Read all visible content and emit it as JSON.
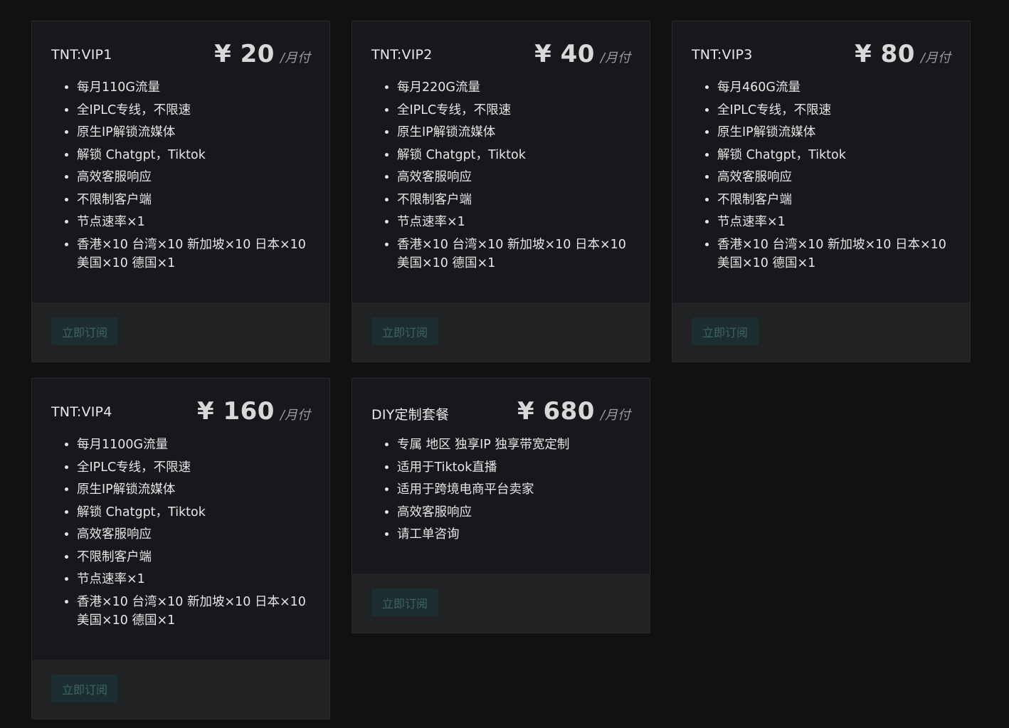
{
  "plans": [
    {
      "name": "TNT:VIP1",
      "price": "¥ 20",
      "unit": "/月付",
      "features": [
        "每月110G流量",
        "全IPLC专线，不限速",
        "原生IP解锁流媒体",
        "解锁 Chatgpt，Tiktok",
        "高效客服响应",
        "不限制客户端",
        "节点速率×1",
        "香港×10 台湾×10 新加坡×10 日本×10 美国×10 德国×1"
      ],
      "button": "立即订阅"
    },
    {
      "name": "TNT:VIP2",
      "price": "¥ 40",
      "unit": "/月付",
      "features": [
        "每月220G流量",
        "全IPLC专线，不限速",
        "原生IP解锁流媒体",
        "解锁 Chatgpt，Tiktok",
        "高效客服响应",
        "不限制客户端",
        "节点速率×1",
        "香港×10 台湾×10 新加坡×10 日本×10 美国×10 德国×1"
      ],
      "button": "立即订阅"
    },
    {
      "name": "TNT:VIP3",
      "price": "¥ 80",
      "unit": "/月付",
      "features": [
        "每月460G流量",
        "全IPLC专线，不限速",
        "原生IP解锁流媒体",
        "解锁 Chatgpt，Tiktok",
        "高效客服响应",
        "不限制客户端",
        "节点速率×1",
        "香港×10 台湾×10 新加坡×10 日本×10 美国×10 德国×1"
      ],
      "button": "立即订阅"
    },
    {
      "name": "TNT:VIP4",
      "price": "¥ 160",
      "unit": "/月付",
      "features": [
        "每月1100G流量",
        "全IPLC专线，不限速",
        "原生IP解锁流媒体",
        "解锁 Chatgpt，Tiktok",
        "高效客服响应",
        "不限制客户端",
        "节点速率×1",
        "香港×10 台湾×10 新加坡×10 日本×10 美国×10 德国×1"
      ],
      "button": "立即订阅"
    },
    {
      "name": "DIY定制套餐",
      "price": "¥ 680",
      "unit": "/月付",
      "features": [
        "专属 地区 独享IP 独享带宽定制",
        "适用于Tiktok直播",
        "适用于跨境电商平台卖家",
        "高效客服响应",
        "请工单咨询"
      ],
      "button": "立即订阅"
    }
  ]
}
